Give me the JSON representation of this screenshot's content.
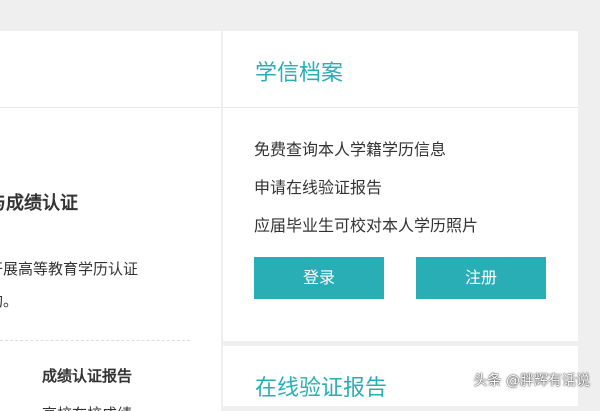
{
  "left_card": {
    "heading": "与成绩认证",
    "description_lines": [
      "开展高等教育学历认证",
      "构。"
    ],
    "report_title": "成绩认证报告",
    "report_item": "高校在校成绩"
  },
  "xuexin_card": {
    "title": "学信档案",
    "features": [
      "免费查询本人学籍学历信息",
      "申请在线验证报告",
      "应届毕业生可校对本人学历照片"
    ],
    "login_label": "登录",
    "register_label": "注册"
  },
  "verify_card": {
    "title": "在线验证报告"
  },
  "watermark": "头条 @胖辉有话说",
  "colors": {
    "accent": "#2aaeb6",
    "background": "#efefef"
  }
}
